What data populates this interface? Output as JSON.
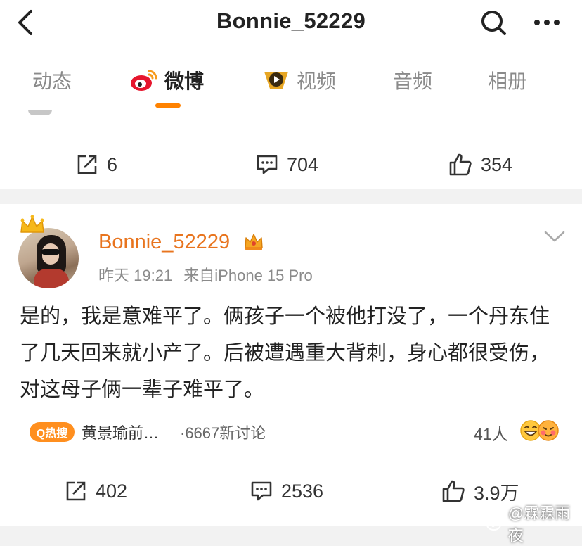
{
  "header": {
    "title": "Bonnie_52229"
  },
  "tabs": [
    {
      "label": "动态",
      "active": false
    },
    {
      "label": "微博",
      "active": true,
      "icon": "weibo-logo-icon"
    },
    {
      "label": "视频",
      "active": false,
      "icon": "video-play-icon"
    },
    {
      "label": "音频",
      "active": false
    },
    {
      "label": "相册",
      "active": false
    }
  ],
  "post1": {
    "reposts": "6",
    "comments": "704",
    "likes": "354"
  },
  "post2": {
    "username": "Bonnie_52229",
    "time": "昨天 19:21",
    "source": "来自iPhone 15 Pro",
    "text": "是的，我是意难平了。俩孩子一个被他打没了，一个丹东住了几天回来就小产了。后被遭遇重大背刺，身心都很受伤，对这母子俩一辈子难平了。",
    "hot_badge": "Q热搜",
    "topic": "黄景瑜前…",
    "topic_count": "·6667新讨论",
    "people": "41人",
    "reposts": "402",
    "comments": "2536",
    "likes": "3.9万"
  },
  "watermark": "@霖霖雨夜",
  "colors": {
    "accent": "#ff8200",
    "username": "#e8741e"
  }
}
